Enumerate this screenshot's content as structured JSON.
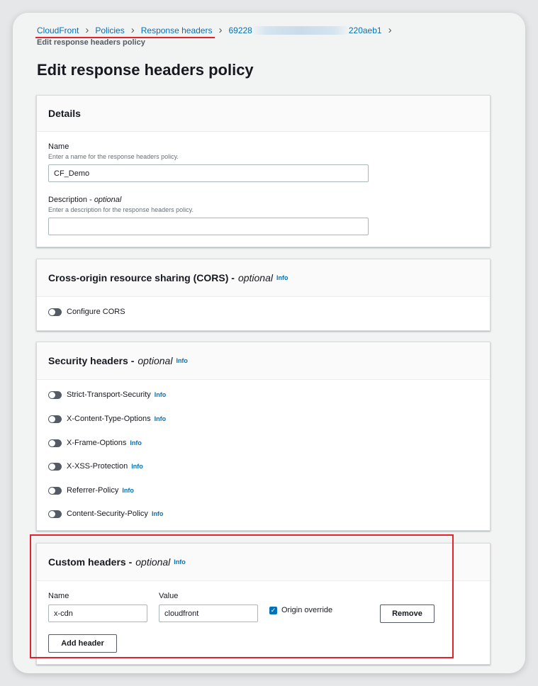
{
  "breadcrumb": {
    "items": [
      "CloudFront",
      "Policies",
      "Response headers"
    ],
    "policy_id_prefix": "69228",
    "policy_id_suffix": "220aeb1",
    "subtitle": "Edit response headers policy"
  },
  "page_title": "Edit response headers policy",
  "details": {
    "title": "Details",
    "name_label": "Name",
    "name_hint": "Enter a name for the response headers policy.",
    "name_value": "CF_Demo",
    "description_label": "Description",
    "description_optional": "optional",
    "description_hint": "Enter a description for the response headers policy.",
    "description_value": ""
  },
  "cors": {
    "title": "Cross-origin resource sharing (CORS) -",
    "optional": "optional",
    "info": "Info",
    "toggle_label": "Configure CORS"
  },
  "security": {
    "title": "Security headers -",
    "optional": "optional",
    "info": "Info",
    "items": [
      {
        "label": "Strict-Transport-Security",
        "info": "Info"
      },
      {
        "label": "X-Content-Type-Options",
        "info": "Info"
      },
      {
        "label": "X-Frame-Options",
        "info": "Info"
      },
      {
        "label": "X-XSS-Protection",
        "info": "Info"
      },
      {
        "label": "Referrer-Policy",
        "info": "Info"
      },
      {
        "label": "Content-Security-Policy",
        "info": "Info"
      }
    ]
  },
  "custom": {
    "title": "Custom headers -",
    "optional": "optional",
    "info": "Info",
    "name_label": "Name",
    "value_label": "Value",
    "name_value": "x-cdn",
    "value_value": "cloudfront",
    "origin_override_label": "Origin override",
    "remove_label": "Remove",
    "add_label": "Add header"
  },
  "colors": {
    "link": "#0073bb",
    "highlight": "#e0232d",
    "toggle_off": "#545b64"
  }
}
